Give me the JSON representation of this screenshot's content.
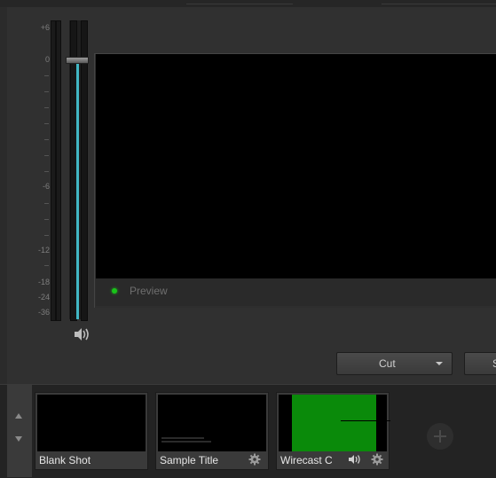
{
  "audio": {
    "scale_labels": [
      "+6",
      "0",
      "-6",
      "-12",
      "-18",
      "-24",
      "-36"
    ]
  },
  "preview": {
    "label": "Preview",
    "status_color": "#19c419"
  },
  "transition": {
    "cut_label": "Cut",
    "second_label": "S"
  },
  "shots": [
    {
      "label": "Blank Shot"
    },
    {
      "label": "Sample Title"
    },
    {
      "label": "Wirecast Ca"
    }
  ],
  "colors": {
    "accent": "#41b7c4",
    "green_thumb": "#0a8a0a"
  }
}
